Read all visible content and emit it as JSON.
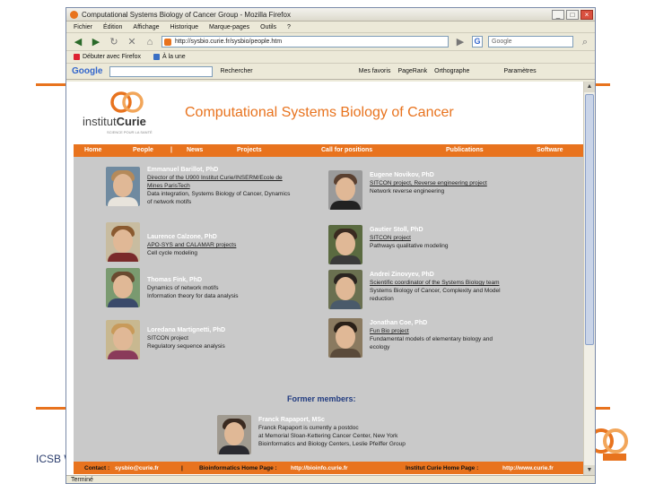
{
  "slide": {
    "footer_text": "ICSB W",
    "accent_color": "#e8731e"
  },
  "window": {
    "title": "Computational Systems Biology of Cancer Group - Mozilla Firefox",
    "buttons": [
      "_",
      "□",
      "×"
    ]
  },
  "menu": [
    "Fichier",
    "Édition",
    "Affichage",
    "Historique",
    "Marque-pages",
    "Outils",
    "?"
  ],
  "navbar": {
    "url": "http://sysbio.curie.fr/sysbio/people.htm",
    "search_placeholder": "Google",
    "search_engine": "G"
  },
  "bookmarks": [
    "Débuter avec Firefox",
    "À la une"
  ],
  "googlebar": {
    "logo": "Google",
    "items": [
      "Rechercher",
      "Mes favoris",
      "PageRank",
      "Orthographe",
      "Paramètres"
    ]
  },
  "status": "Terminé",
  "site": {
    "logo_text": "institut",
    "logo_bold": "Curie",
    "logo_sub": "SCIENCE POUR LA SANTÉ",
    "title": "Computational Systems Biology of Cancer",
    "nav": [
      "Home",
      "People",
      "|",
      "News",
      "Projects",
      "Call for positions",
      "Publications",
      "Software"
    ],
    "people": [
      {
        "name": "Emmanuel Barillot, PhD",
        "lines": [
          {
            "text": "Director of the U900 Institut Curie/INSERM/Ecole de",
            "link": true
          },
          {
            "text": "Mines ParisTech",
            "link": true
          },
          {
            "text": "Data integration, Systems Biology of Cancer, Dynamics",
            "link": false
          },
          {
            "text": "of network motifs",
            "link": false
          }
        ]
      },
      {
        "name": "Eugene Novikov, PhD",
        "lines": [
          {
            "text": "SITCON project, Reverse engineering project",
            "link": true
          },
          {
            "text": "Network reverse engineering",
            "link": false
          }
        ]
      },
      {
        "name": "Laurence Calzone, PhD",
        "lines": [
          {
            "text": "APO-SYS and CALAMAR projects",
            "link": true
          },
          {
            "text": "Cell cycle modeling",
            "link": false
          }
        ]
      },
      {
        "name": "Gautier Stoll, PhD",
        "lines": [
          {
            "text": "SITCON project",
            "link": true
          },
          {
            "text": "Pathways qualitative modeling",
            "link": false
          }
        ]
      },
      {
        "name": "Andrei Zinovyev, PhD",
        "lines": [
          {
            "text": "Scientific coordinator of the Systems Biology team",
            "link": true
          },
          {
            "text": "Systems Biology of Cancer, Complexity and Model",
            "link": false
          },
          {
            "text": "reduction",
            "link": false
          }
        ]
      },
      {
        "name": "Thomas Fink, PhD",
        "lines": [
          {
            "text": "Dynamics of network motifs",
            "link": false
          },
          {
            "text": "Information theory for data analysis",
            "link": false
          }
        ]
      },
      {
        "name": "Loredana Martignetti, PhD",
        "lines": [
          {
            "text": "SITCON project",
            "link": false
          },
          {
            "text": "Regulatory sequence analysis",
            "link": false
          }
        ]
      },
      {
        "name": "Jonathan Coe, PhD",
        "lines": [
          {
            "text": "Fun Bio project",
            "link": true
          },
          {
            "text": "Fundamental models of elementary biology and",
            "link": false
          },
          {
            "text": "ecology",
            "link": false
          }
        ]
      }
    ],
    "former_title": "Former members:",
    "former": [
      {
        "name": "Franck Rapaport, MSc",
        "lines": [
          {
            "text": "Franck Rapaport is currently a postdoc",
            "link": false
          },
          {
            "text": "at Memorial Sloan-Kettering Cancer Center, New York",
            "link": false
          },
          {
            "text": "Bioinformatics and Biology Centers, Leslie Pfeiffer Group",
            "link": false
          }
        ]
      }
    ],
    "footer": {
      "contact_label": "Contact :",
      "contact_value": "sysbio@curie.fr",
      "sep": "|",
      "bioinfo_label": "Bioinformatics Home Page :",
      "bioinfo_value": "http://bioinfo.curie.fr",
      "curie_label": "Institut Curie Home Page :",
      "curie_value": "http://www.curie.fr"
    }
  }
}
